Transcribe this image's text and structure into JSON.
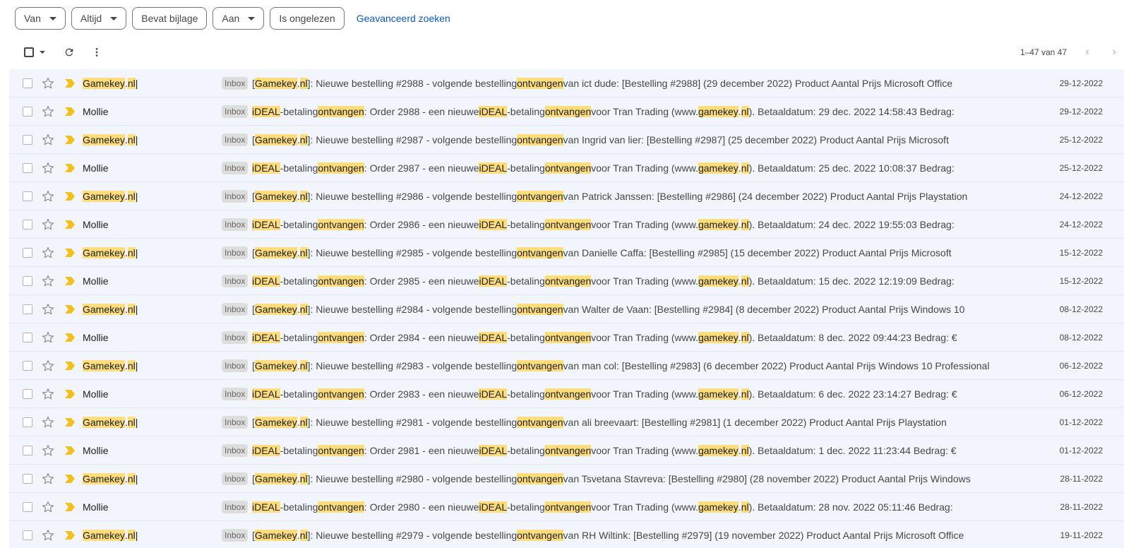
{
  "filters": {
    "chips": [
      {
        "label": "Van",
        "dropdown": true
      },
      {
        "label": "Altijd",
        "dropdown": true
      },
      {
        "label": "Bevat bijlage",
        "dropdown": false
      },
      {
        "label": "Aan",
        "dropdown": true
      },
      {
        "label": "Is ongelezen",
        "dropdown": false
      }
    ],
    "advanced_search": "Geavanceerd zoeken"
  },
  "toolbar": {
    "pagination": "1–47 van 47"
  },
  "colors": {
    "highlight": "#fddc7c",
    "row_background": "#f2f6fc",
    "important_marker": "#f2c01d",
    "link": "#0b57d0"
  },
  "emails": [
    {
      "sender": "Gamekey.nl |",
      "label": "Inbox",
      "subject": "[Gamekey.nl]: Nieuwe bestelling #2988 - volgende bestelling ontvangen van ict dude: [Bestelling #2988] (29 december 2022) Product Aantal Prijs Microsoft Office",
      "date": "29-12-2022"
    },
    {
      "sender": "Mollie",
      "label": "Inbox",
      "subject": "iDEAL-betaling ontvangen: Order 2988 - een nieuwe iDEAL-betaling ontvangen voor Tran Trading (www.gamekey.nl). Betaaldatum: 29 dec. 2022 14:58:43 Bedrag:",
      "date": "29-12-2022"
    },
    {
      "sender": "Gamekey.nl |",
      "label": "Inbox",
      "subject": "[Gamekey.nl]: Nieuwe bestelling #2987 - volgende bestelling ontvangen van Ingrid van lier: [Bestelling #2987] (25 december 2022) Product Aantal Prijs Microsoft",
      "date": "25-12-2022"
    },
    {
      "sender": "Mollie",
      "label": "Inbox",
      "subject": "iDEAL-betaling ontvangen: Order 2987 - een nieuwe iDEAL-betaling ontvangen voor Tran Trading (www.gamekey.nl). Betaaldatum: 25 dec. 2022 10:08:37 Bedrag:",
      "date": "25-12-2022"
    },
    {
      "sender": "Gamekey.nl |",
      "label": "Inbox",
      "subject": "[Gamekey.nl]: Nieuwe bestelling #2986 - volgende bestelling ontvangen van Patrick Janssen: [Bestelling #2986] (24 december 2022) Product Aantal Prijs Playstation",
      "date": "24-12-2022"
    },
    {
      "sender": "Mollie",
      "label": "Inbox",
      "subject": "iDEAL-betaling ontvangen: Order 2986 - een nieuwe iDEAL-betaling ontvangen voor Tran Trading (www.gamekey.nl). Betaaldatum: 24 dec. 2022 19:55:03 Bedrag:",
      "date": "24-12-2022"
    },
    {
      "sender": "Gamekey.nl |",
      "label": "Inbox",
      "subject": "[Gamekey.nl]: Nieuwe bestelling #2985 - volgende bestelling ontvangen van Danielle Caffa: [Bestelling #2985] (15 december 2022) Product Aantal Prijs Microsoft",
      "date": "15-12-2022"
    },
    {
      "sender": "Mollie",
      "label": "Inbox",
      "subject": "iDEAL-betaling ontvangen: Order 2985 - een nieuwe iDEAL-betaling ontvangen voor Tran Trading (www.gamekey.nl). Betaaldatum: 15 dec. 2022 12:19:09 Bedrag:",
      "date": "15-12-2022"
    },
    {
      "sender": "Gamekey.nl |",
      "label": "Inbox",
      "subject": "[Gamekey.nl]: Nieuwe bestelling #2984 - volgende bestelling ontvangen van Walter de Vaan: [Bestelling #2984] (8 december 2022) Product Aantal Prijs Windows 10",
      "date": "08-12-2022"
    },
    {
      "sender": "Mollie",
      "label": "Inbox",
      "subject": "iDEAL-betaling ontvangen: Order 2984 - een nieuwe iDEAL-betaling ontvangen voor Tran Trading (www.gamekey.nl). Betaaldatum: 8 dec. 2022 09:44:23 Bedrag: €",
      "date": "08-12-2022"
    },
    {
      "sender": "Gamekey.nl |",
      "label": "Inbox",
      "subject": "[Gamekey.nl]: Nieuwe bestelling #2983 - volgende bestelling ontvangen van man col: [Bestelling #2983] (6 december 2022) Product Aantal Prijs Windows 10 Professional",
      "date": "06-12-2022"
    },
    {
      "sender": "Mollie",
      "label": "Inbox",
      "subject": "iDEAL-betaling ontvangen: Order 2983 - een nieuwe iDEAL-betaling ontvangen voor Tran Trading (www.gamekey.nl). Betaaldatum: 6 dec. 2022 23:14:27 Bedrag: €",
      "date": "06-12-2022"
    },
    {
      "sender": "Gamekey.nl |",
      "label": "Inbox",
      "subject": "[Gamekey.nl]: Nieuwe bestelling #2981 - volgende bestelling ontvangen van ali breevaart: [Bestelling #2981] (1 december 2022) Product Aantal Prijs Playstation",
      "date": "01-12-2022"
    },
    {
      "sender": "Mollie",
      "label": "Inbox",
      "subject": "iDEAL-betaling ontvangen: Order 2981 - een nieuwe iDEAL-betaling ontvangen voor Tran Trading (www.gamekey.nl). Betaaldatum: 1 dec. 2022 11:23:44 Bedrag: €",
      "date": "01-12-2022"
    },
    {
      "sender": "Gamekey.nl |",
      "label": "Inbox",
      "subject": "[Gamekey.nl]: Nieuwe bestelling #2980 - volgende bestelling ontvangen van Tsvetana Stavreva: [Bestelling #2980] (28 november 2022) Product Aantal Prijs Windows",
      "date": "28-11-2022"
    },
    {
      "sender": "Mollie",
      "label": "Inbox",
      "subject": "iDEAL-betaling ontvangen: Order 2980 - een nieuwe iDEAL-betaling ontvangen voor Tran Trading (www.gamekey.nl). Betaaldatum: 28 nov. 2022 05:11:46 Bedrag:",
      "date": "28-11-2022"
    },
    {
      "sender": "Gamekey.nl |",
      "label": "Inbox",
      "subject": "[Gamekey.nl]: Nieuwe bestelling #2979 - volgende bestelling ontvangen van RH Wiltink: [Bestelling #2979] (19 november 2022) Product Aantal Prijs Microsoft Office",
      "date": "19-11-2022"
    }
  ],
  "highlight_terms": [
    "Gamekey",
    "gamekey",
    "nl",
    "iDEAL",
    "ontvangen"
  ]
}
